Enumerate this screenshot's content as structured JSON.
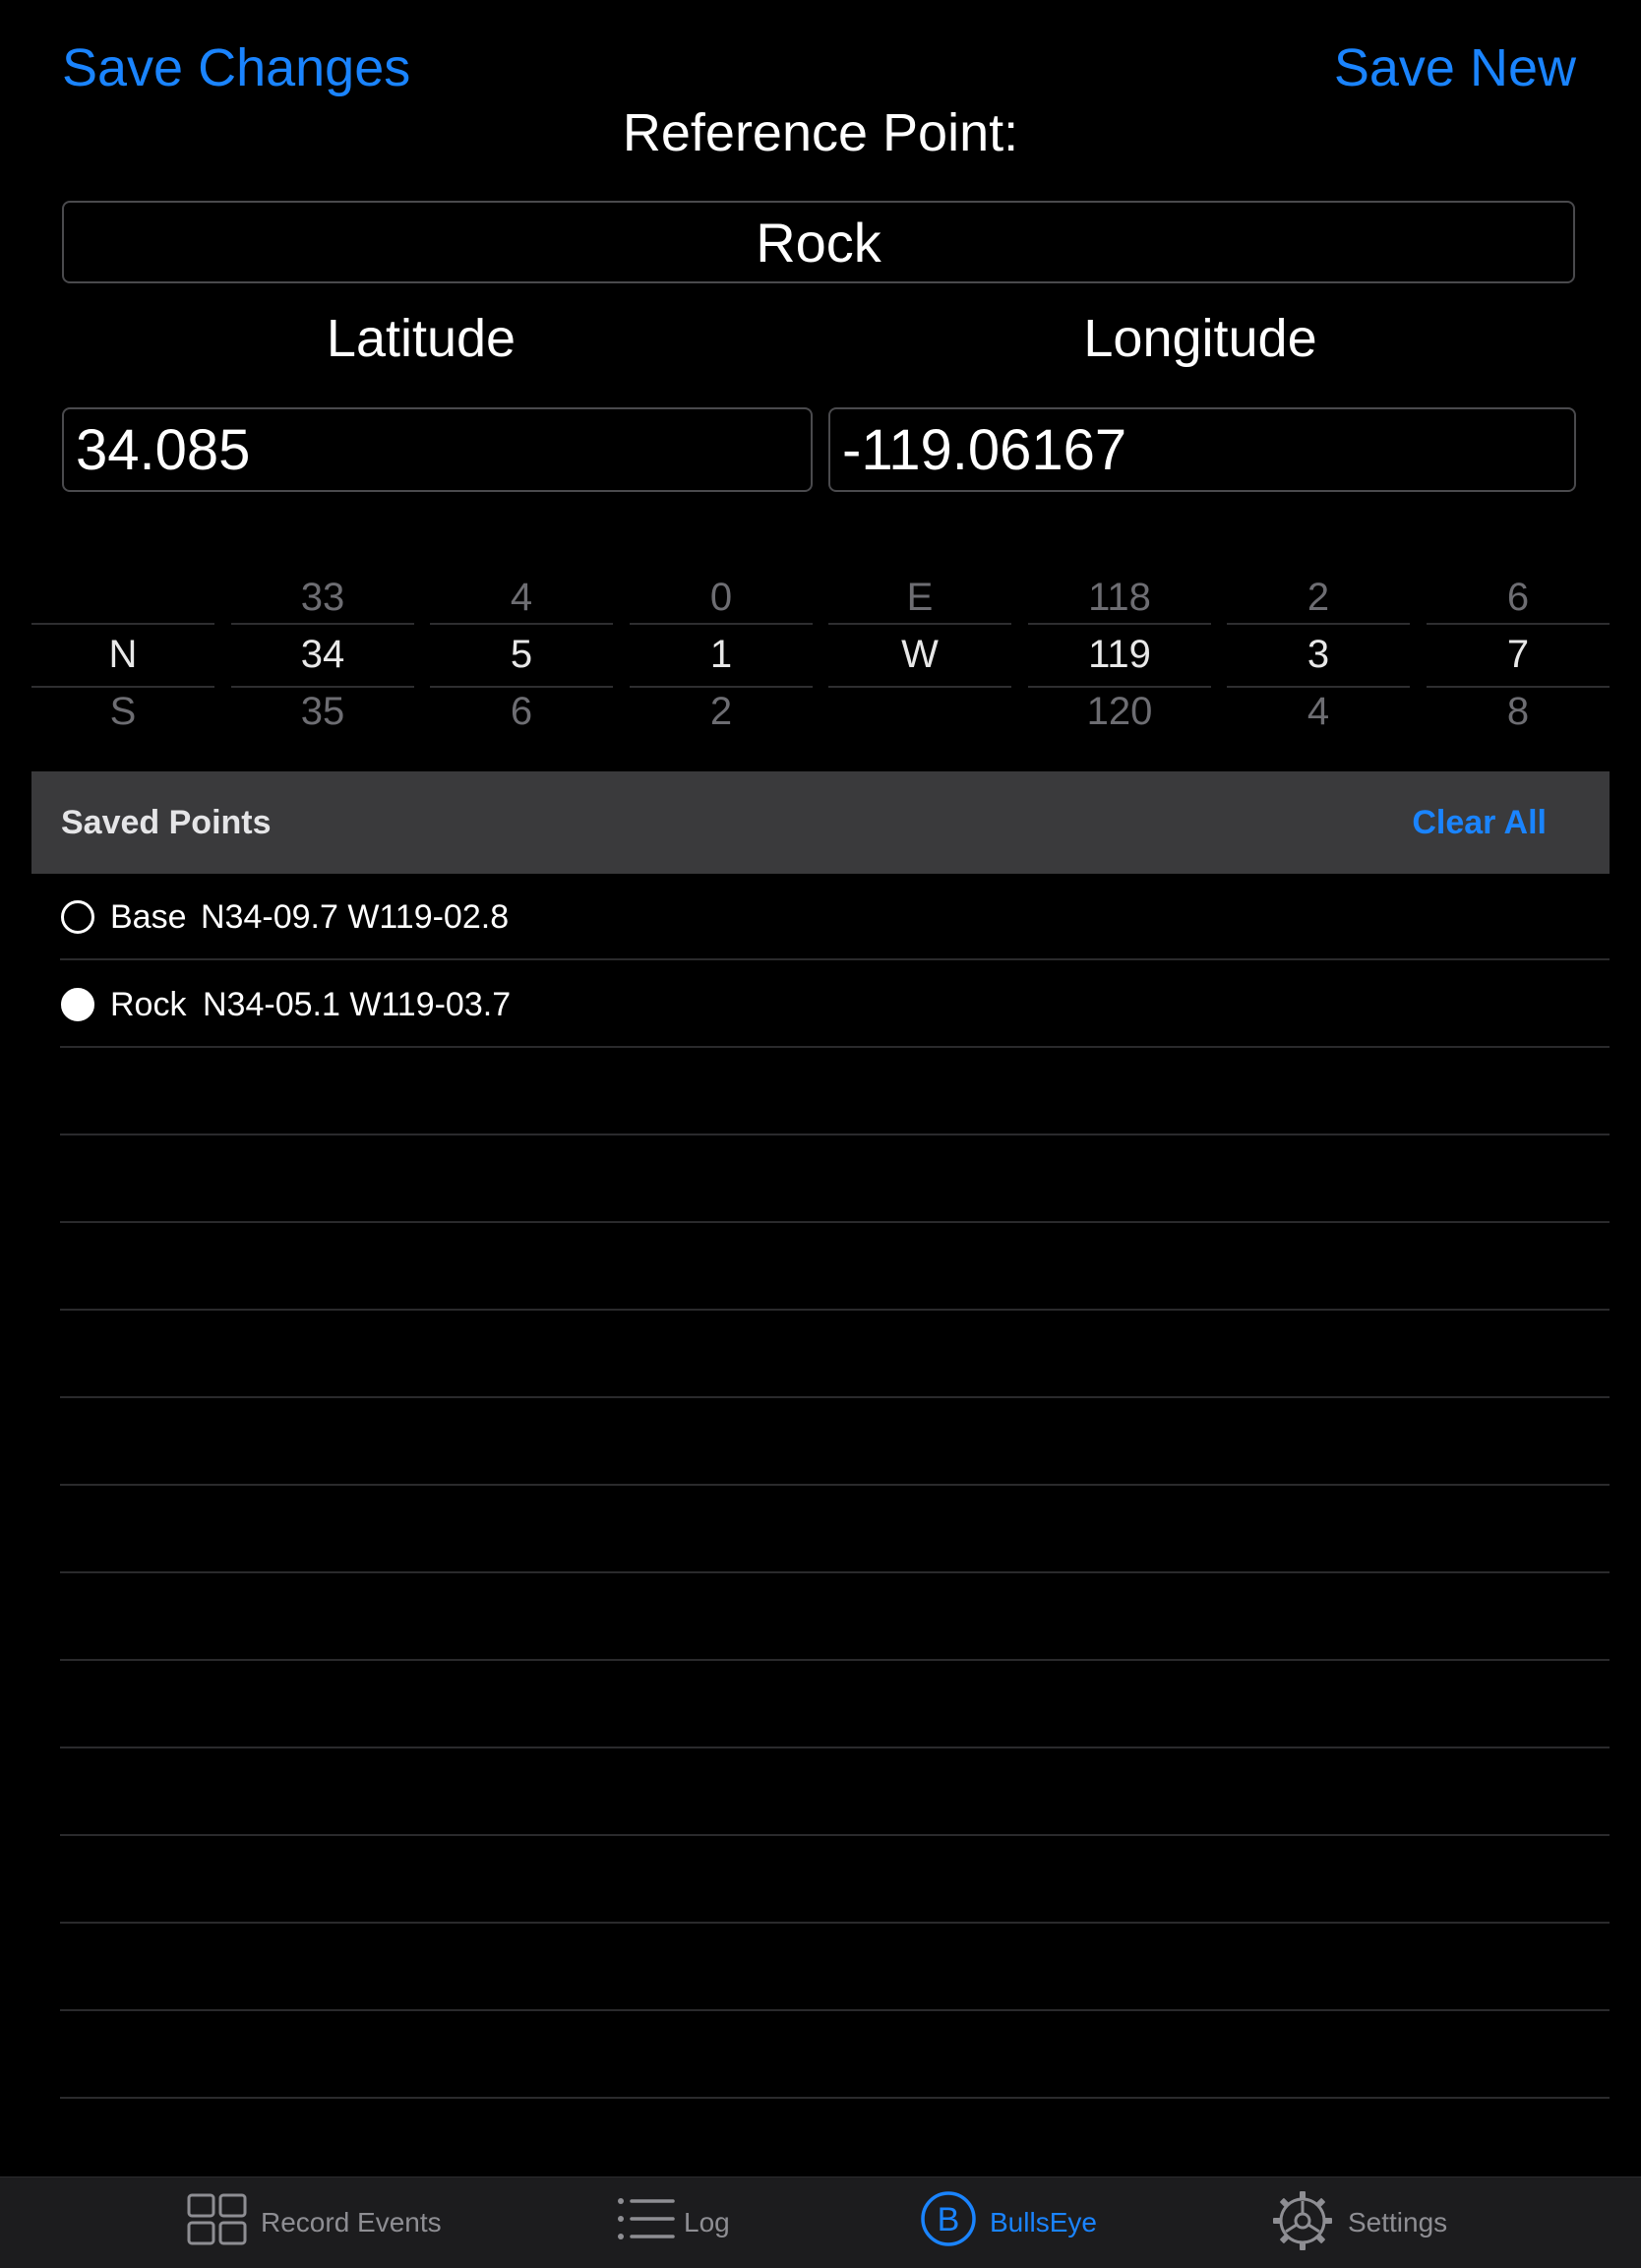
{
  "header": {
    "save_changes_label": "Save Changes",
    "save_new_label": "Save New",
    "title": "Reference Point:"
  },
  "reference": {
    "name": "Rock"
  },
  "coordinates": {
    "latitude_label": "Latitude",
    "longitude_label": "Longitude",
    "latitude_value": "34.085",
    "longitude_value": "-119.06167"
  },
  "pickers": [
    {
      "above": "",
      "selected": "N",
      "below": "S"
    },
    {
      "above": "33",
      "selected": "34",
      "below": "35"
    },
    {
      "above": "4",
      "selected": "5",
      "below": "6"
    },
    {
      "above": "0",
      "selected": "1",
      "below": "2"
    },
    {
      "above": "E",
      "selected": "W",
      "below": ""
    },
    {
      "above": "118",
      "selected": "119",
      "below": "120"
    },
    {
      "above": "2",
      "selected": "3",
      "below": "4"
    },
    {
      "above": "6",
      "selected": "7",
      "below": "8"
    }
  ],
  "saved_points": {
    "title": "Saved Points",
    "clear_all_label": "Clear All",
    "items": [
      {
        "name": "Base",
        "coord": "N34-09.7 W119-02.8",
        "selected": false
      },
      {
        "name": "Rock",
        "coord": "N34-05.1 W119-03.7",
        "selected": true
      }
    ]
  },
  "tabbar": {
    "tabs": [
      {
        "label": "Record Events",
        "icon": "grid-icon",
        "active": false
      },
      {
        "label": "Log",
        "icon": "list-icon",
        "active": false
      },
      {
        "label": "BullsEye",
        "icon": "bullseye-b-icon",
        "active": true
      },
      {
        "label": "Settings",
        "icon": "gear-icon",
        "active": false
      }
    ]
  },
  "colors": {
    "accent": "#1a84ff",
    "background": "#000000",
    "header_bg": "#3a3a3c",
    "tabbar_bg": "#1c1c1e",
    "inactive": "#8e8e93"
  }
}
